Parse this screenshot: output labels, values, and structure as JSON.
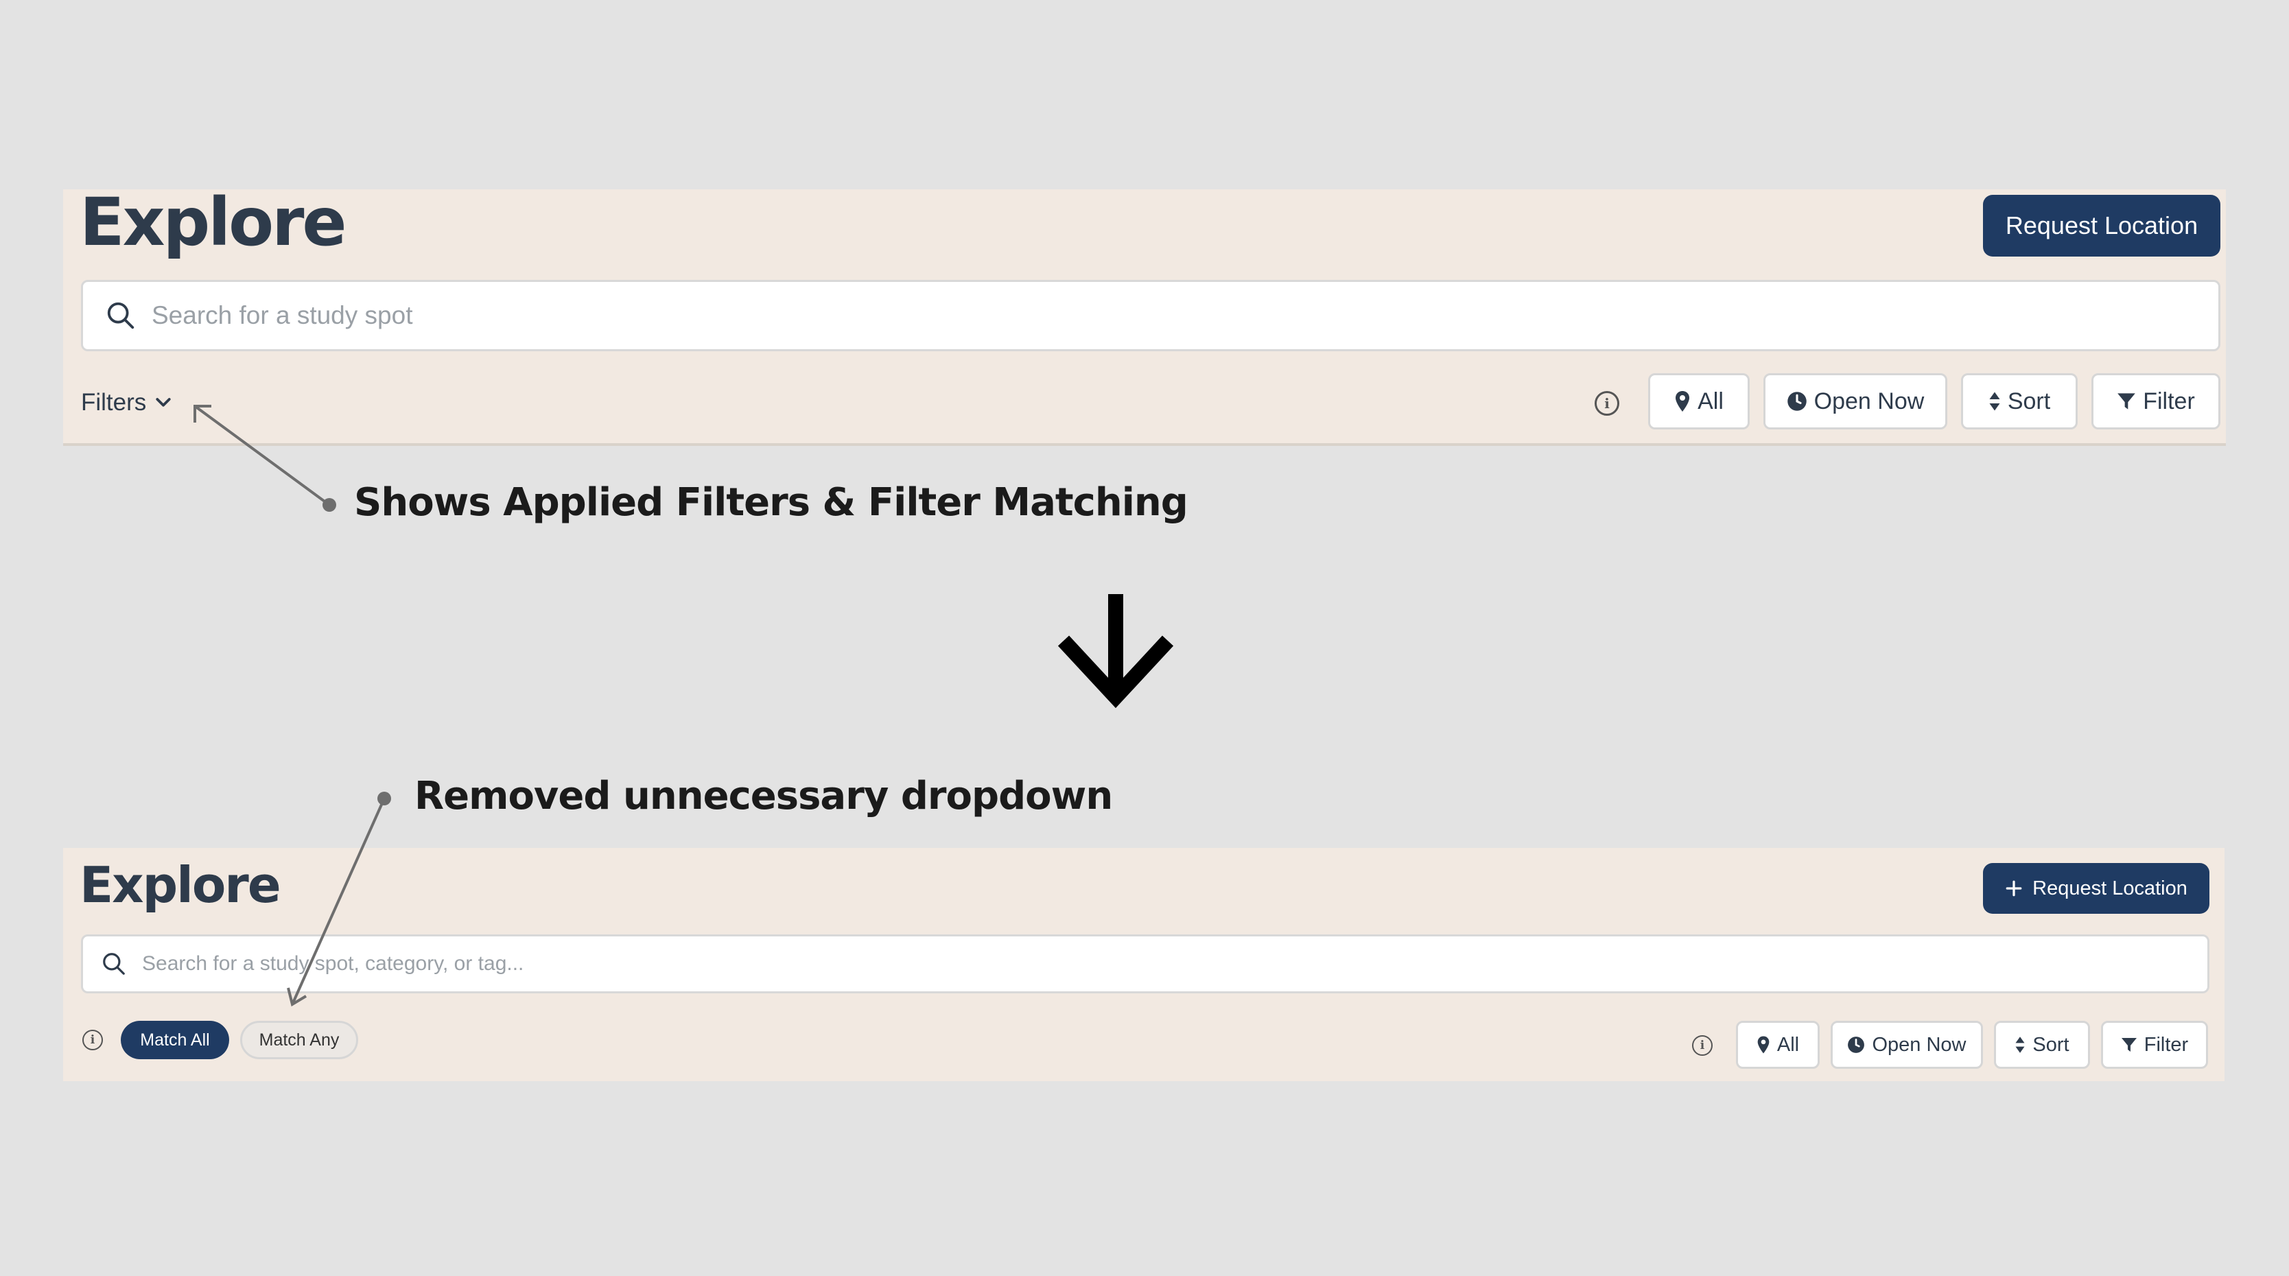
{
  "before": {
    "title": "Explore",
    "request_button": "Request Location",
    "search_placeholder": "Search for a study spot",
    "filters_label": "Filters",
    "buttons": {
      "all": "All",
      "open_now": "Open Now",
      "sort": "Sort",
      "filter": "Filter"
    }
  },
  "after": {
    "title": "Explore",
    "request_button": "Request Location",
    "search_placeholder": "Search for a study spot, category, or tag...",
    "match_all": "Match All",
    "match_any": "Match Any",
    "buttons": {
      "all": "All",
      "open_now": "Open Now",
      "sort": "Sort",
      "filter": "Filter"
    }
  },
  "annotations": {
    "top": "Shows Applied Filters & Filter Matching",
    "bottom": "Removed unnecessary dropdown"
  },
  "colors": {
    "panel": "#f2e9e1",
    "primary": "#1f3b63",
    "title": "#2e3b4b",
    "background": "#e3e3e3"
  },
  "icons": [
    "search-icon",
    "chevron-down-icon",
    "info-icon",
    "location-pin-icon",
    "clock-icon",
    "sort-icon",
    "funnel-icon",
    "plus-icon",
    "down-arrow-icon"
  ]
}
